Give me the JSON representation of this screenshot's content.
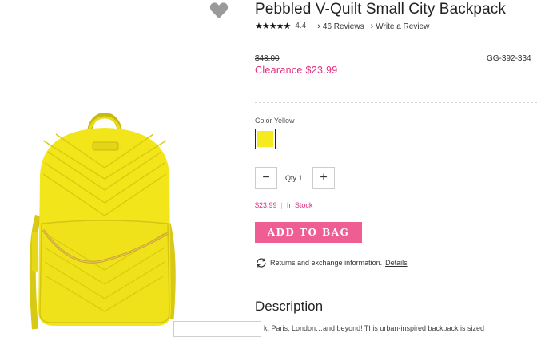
{
  "product": {
    "title": "Pebbled V-Quilt Small City Backpack",
    "stars": "★★★★★",
    "rating": "4.4",
    "reviews_link": "46 Reviews",
    "write_review_link": "Write a Review",
    "original_price": "$48.00",
    "sku": "GG-392-334",
    "sale_price": "Clearance $23.99",
    "color_label": "Color Yellow",
    "swatch_color": "#f4ea1e",
    "qty_label": "Qty 1",
    "qty_minus": "−",
    "qty_plus": "+",
    "price": "$23.99",
    "separator": "|",
    "stock_status": "In Stock",
    "add_to_bag": "ADD TO BAG",
    "returns_text": "Returns and exchange information.",
    "returns_link": "Details",
    "description_heading": "Description",
    "description_text": "k. Paris, London…and beyond! This urban-inspired backpack is sized"
  },
  "icons": {
    "wishlist": "heart-icon",
    "chevron": "chevron-right-icon",
    "returns": "returns-exchange-icon"
  },
  "colors": {
    "accent_pink": "#e0317d",
    "button_pink": "#ef5e92",
    "product_yellow": "#f4ea1e"
  }
}
